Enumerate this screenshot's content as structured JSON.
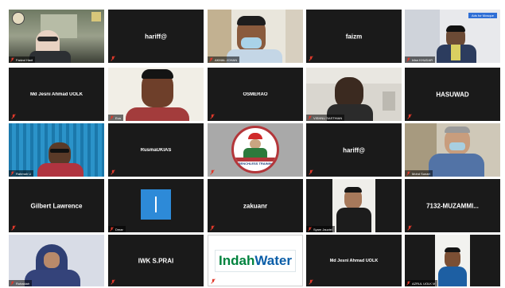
{
  "tiles": [
    {
      "label": "hariff@",
      "kind": "name"
    },
    {
      "label": "faizm",
      "kind": "name"
    },
    {
      "label": "Md Jesni Ahmad UOLK",
      "kind": "name"
    },
    {
      "label": "OSMERAO",
      "kind": "name"
    },
    {
      "label": "HASUWAD",
      "kind": "name"
    },
    {
      "label": "RusmaUKIAS",
      "kind": "name"
    },
    {
      "label": "hariff@",
      "kind": "name"
    },
    {
      "label": "Gilbert Lawrence",
      "kind": "name"
    },
    {
      "label": "zakuanr",
      "kind": "name"
    },
    {
      "label": "7132-MUZAMMI...",
      "kind": "name"
    },
    {
      "label": "IWK S.PRAI",
      "kind": "name"
    },
    {
      "label": "Md Jesni Ahmad UOLK",
      "kind": "name"
    }
  ],
  "video_labels": {
    "t1": "Fadzul Hadi",
    "t3": "AKMAL JOHAN",
    "t5": "Irfan KHUDAR",
    "t7": "Eva",
    "t9": "VISHNU SASTHIAN",
    "t11": "Rahmah U",
    "t15": "Mohd Sunari",
    "t17": "Dmar",
    "t19": "Syam Jauziel",
    "t21": "Ruhaidah",
    "t25": "AZRUL UOLK M"
  },
  "badge": "Ads for Mosque",
  "logo_text": "TRENCHLESS TRAINING",
  "indah": {
    "a": "Indah",
    "b": "Water"
  },
  "colors": {
    "tile_bg": "#1a1a1a",
    "active_outline": "#e3d64a",
    "muted_red": "#e0392b"
  }
}
